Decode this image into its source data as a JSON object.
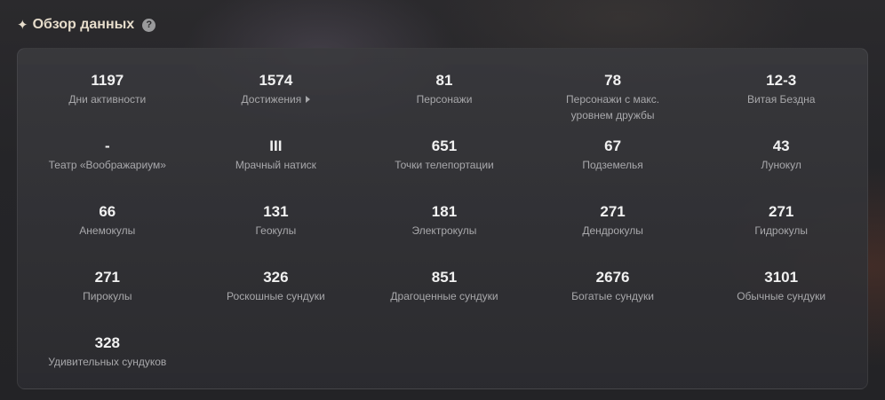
{
  "header": {
    "title": "Обзор данных",
    "sparkle_icon": "✦",
    "help_icon": "?"
  },
  "stats": [
    {
      "value": "1197",
      "label": "Дни активности"
    },
    {
      "value": "1574",
      "label": "Достижения",
      "link": true
    },
    {
      "value": "81",
      "label": "Персонажи"
    },
    {
      "value": "78",
      "label": "Персонажи с макс. уровнем дружбы"
    },
    {
      "value": "12-3",
      "label": "Витая Бездна"
    },
    {
      "value": "-",
      "label": "Театр «Воображариум»"
    },
    {
      "value": "III",
      "label": "Мрачный натиск"
    },
    {
      "value": "651",
      "label": "Точки телепортации"
    },
    {
      "value": "67",
      "label": "Подземелья"
    },
    {
      "value": "43",
      "label": "Лунокул"
    },
    {
      "value": "66",
      "label": "Анемокулы"
    },
    {
      "value": "131",
      "label": "Геокулы"
    },
    {
      "value": "181",
      "label": "Электрокулы"
    },
    {
      "value": "271",
      "label": "Дендрокулы"
    },
    {
      "value": "271",
      "label": "Гидрокулы"
    },
    {
      "value": "271",
      "label": "Пирокулы"
    },
    {
      "value": "326",
      "label": "Роскошные сундуки"
    },
    {
      "value": "851",
      "label": "Драгоценные сундуки"
    },
    {
      "value": "2676",
      "label": "Богатые сундуки"
    },
    {
      "value": "3101",
      "label": "Обычные сундуки"
    },
    {
      "value": "328",
      "label": "Удивительных сундуков"
    }
  ]
}
